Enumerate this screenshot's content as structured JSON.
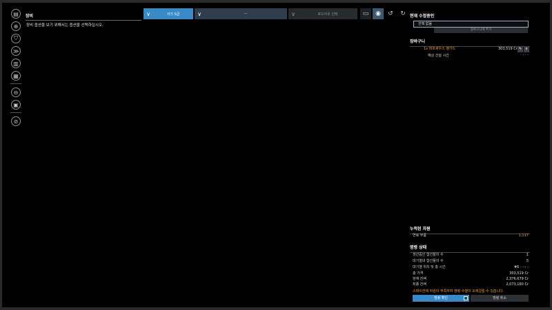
{
  "left_toolbar": {
    "icons": [
      "slot-icon",
      "crosshair-icon",
      "shield-icon",
      "engine-icon",
      "battery-icon",
      "cargo-icon",
      "drone-icon",
      "trash-icon",
      "prohibit-icon"
    ]
  },
  "equipment": {
    "title": "장비",
    "hint": "장비 옵션을 보기 위해서는 옵션을 선택하십시오."
  },
  "top_bar": {
    "size_dropdown": "크기 S급",
    "middle_dropdown": "---",
    "loadout_dropdown": "로드아웃 선택"
  },
  "current_ship": {
    "title": "현재 수정중인",
    "selected_value": "선택 없음",
    "add_to_cart": "장바구니에 추가"
  },
  "cart": {
    "title": "장바구니",
    "item_name": "1x 퍼르세우스 뱅가드",
    "item_price": "303,519 Cr",
    "edit_icon": "pencil-icon",
    "delete_icon": "x-icon",
    "build_time_label": "예상 건설 시간",
    "build_time_value": "- -:- -"
  },
  "resources": {
    "title": "누적된 자원",
    "rows": [
      {
        "label": "연료 부품",
        "value": "1,117"
      }
    ]
  },
  "order_status": {
    "title": "명령 상태",
    "rows": [
      {
        "label": "생산중인 함선들의 수",
        "value": "1"
      },
      {
        "label": "대기열내 함선들의 수",
        "value": "5"
      },
      {
        "label": "대기열 위치 및 총 시간",
        "value": "#6 - -:- -"
      },
      {
        "label": "총 가격",
        "value": "303,519 Cr"
      },
      {
        "label": "현재 잔액",
        "value": "2,376,679 Cr"
      },
      {
        "label": "최종 잔액",
        "value": "2,073,160 Cr"
      }
    ],
    "warning": "스테이션에 자원이 부족하여 명령 수행이 오래걸릴 수 있습니다.",
    "confirm_label": "명령 확인",
    "cancel_label": "명령 취소"
  },
  "colors": {
    "accent": "#3a8ac8",
    "warning": "#f0a43a",
    "background": "#000000"
  }
}
